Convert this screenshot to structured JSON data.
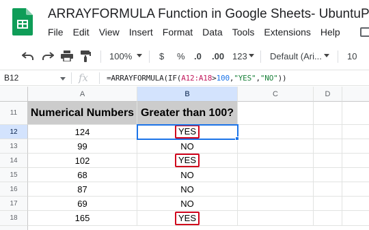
{
  "app": {
    "title": "ARRAYFORMULA Function in Google Sheets- UbuntuPIT",
    "menu": [
      "File",
      "Edit",
      "View",
      "Insert",
      "Format",
      "Data",
      "Tools",
      "Extensions",
      "Help"
    ]
  },
  "toolbar": {
    "zoom": "100%",
    "currency": "$",
    "percent": "%",
    "decrease_decimal": ".0",
    "increase_decimal": ".00",
    "more_formats": "123",
    "font": "Default (Ari...",
    "font_size": "10"
  },
  "formula_bar": {
    "cell_ref": "B12",
    "fx": "fx",
    "formula_parts": {
      "p1": "=ARRAYFORMULA(IF(",
      "range": "A12:A18",
      "op": ">",
      "num": "100",
      "comma1": ",",
      "yes": "\"YES\"",
      "comma2": ",",
      "no": "\"NO\"",
      "close": "))"
    }
  },
  "columns": [
    "A",
    "B",
    "C",
    "D"
  ],
  "rows": [
    "11",
    "12",
    "13",
    "14",
    "15",
    "16",
    "17",
    "18"
  ],
  "header_row": {
    "a": "Numerical Numbers",
    "b": "Greater than 100?"
  },
  "data_rows": [
    {
      "a": "124",
      "b": "YES"
    },
    {
      "a": "99",
      "b": "NO"
    },
    {
      "a": "102",
      "b": "YES"
    },
    {
      "a": "68",
      "b": "NO"
    },
    {
      "a": "87",
      "b": "NO"
    },
    {
      "a": "69",
      "b": "NO"
    },
    {
      "a": "165",
      "b": "YES"
    }
  ],
  "colors": {
    "selection": "#1a73e8",
    "highlight_box": "#d0021b",
    "header_fill": "#cccccc"
  }
}
